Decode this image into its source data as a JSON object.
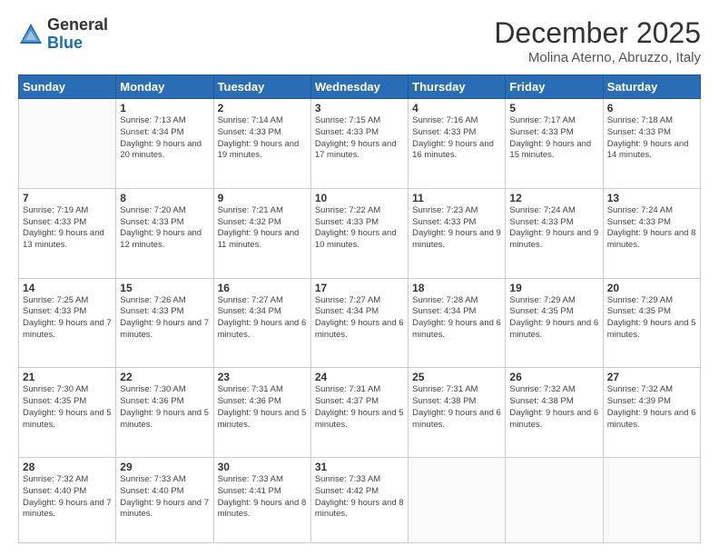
{
  "logo": {
    "general": "General",
    "blue": "Blue"
  },
  "header": {
    "month": "December 2025",
    "location": "Molina Aterno, Abruzzo, Italy"
  },
  "weekdays": [
    "Sunday",
    "Monday",
    "Tuesday",
    "Wednesday",
    "Thursday",
    "Friday",
    "Saturday"
  ],
  "weeks": [
    [
      {
        "day": null
      },
      {
        "day": "1",
        "sunrise": "7:13 AM",
        "sunset": "4:34 PM",
        "daylight": "9 hours and 20 minutes."
      },
      {
        "day": "2",
        "sunrise": "7:14 AM",
        "sunset": "4:33 PM",
        "daylight": "9 hours and 19 minutes."
      },
      {
        "day": "3",
        "sunrise": "7:15 AM",
        "sunset": "4:33 PM",
        "daylight": "9 hours and 17 minutes."
      },
      {
        "day": "4",
        "sunrise": "7:16 AM",
        "sunset": "4:33 PM",
        "daylight": "9 hours and 16 minutes."
      },
      {
        "day": "5",
        "sunrise": "7:17 AM",
        "sunset": "4:33 PM",
        "daylight": "9 hours and 15 minutes."
      },
      {
        "day": "6",
        "sunrise": "7:18 AM",
        "sunset": "4:33 PM",
        "daylight": "9 hours and 14 minutes."
      }
    ],
    [
      {
        "day": "7",
        "sunrise": "7:19 AM",
        "sunset": "4:33 PM",
        "daylight": "9 hours and 13 minutes."
      },
      {
        "day": "8",
        "sunrise": "7:20 AM",
        "sunset": "4:33 PM",
        "daylight": "9 hours and 12 minutes."
      },
      {
        "day": "9",
        "sunrise": "7:21 AM",
        "sunset": "4:32 PM",
        "daylight": "9 hours and 11 minutes."
      },
      {
        "day": "10",
        "sunrise": "7:22 AM",
        "sunset": "4:33 PM",
        "daylight": "9 hours and 10 minutes."
      },
      {
        "day": "11",
        "sunrise": "7:23 AM",
        "sunset": "4:33 PM",
        "daylight": "9 hours and 9 minutes."
      },
      {
        "day": "12",
        "sunrise": "7:24 AM",
        "sunset": "4:33 PM",
        "daylight": "9 hours and 9 minutes."
      },
      {
        "day": "13",
        "sunrise": "7:24 AM",
        "sunset": "4:33 PM",
        "daylight": "9 hours and 8 minutes."
      }
    ],
    [
      {
        "day": "14",
        "sunrise": "7:25 AM",
        "sunset": "4:33 PM",
        "daylight": "9 hours and 7 minutes."
      },
      {
        "day": "15",
        "sunrise": "7:26 AM",
        "sunset": "4:33 PM",
        "daylight": "9 hours and 7 minutes."
      },
      {
        "day": "16",
        "sunrise": "7:27 AM",
        "sunset": "4:34 PM",
        "daylight": "9 hours and 6 minutes."
      },
      {
        "day": "17",
        "sunrise": "7:27 AM",
        "sunset": "4:34 PM",
        "daylight": "9 hours and 6 minutes."
      },
      {
        "day": "18",
        "sunrise": "7:28 AM",
        "sunset": "4:34 PM",
        "daylight": "9 hours and 6 minutes."
      },
      {
        "day": "19",
        "sunrise": "7:29 AM",
        "sunset": "4:35 PM",
        "daylight": "9 hours and 6 minutes."
      },
      {
        "day": "20",
        "sunrise": "7:29 AM",
        "sunset": "4:35 PM",
        "daylight": "9 hours and 5 minutes."
      }
    ],
    [
      {
        "day": "21",
        "sunrise": "7:30 AM",
        "sunset": "4:35 PM",
        "daylight": "9 hours and 5 minutes."
      },
      {
        "day": "22",
        "sunrise": "7:30 AM",
        "sunset": "4:36 PM",
        "daylight": "9 hours and 5 minutes."
      },
      {
        "day": "23",
        "sunrise": "7:31 AM",
        "sunset": "4:36 PM",
        "daylight": "9 hours and 5 minutes."
      },
      {
        "day": "24",
        "sunrise": "7:31 AM",
        "sunset": "4:37 PM",
        "daylight": "9 hours and 5 minutes."
      },
      {
        "day": "25",
        "sunrise": "7:31 AM",
        "sunset": "4:38 PM",
        "daylight": "9 hours and 6 minutes."
      },
      {
        "day": "26",
        "sunrise": "7:32 AM",
        "sunset": "4:38 PM",
        "daylight": "9 hours and 6 minutes."
      },
      {
        "day": "27",
        "sunrise": "7:32 AM",
        "sunset": "4:39 PM",
        "daylight": "9 hours and 6 minutes."
      }
    ],
    [
      {
        "day": "28",
        "sunrise": "7:32 AM",
        "sunset": "4:40 PM",
        "daylight": "9 hours and 7 minutes."
      },
      {
        "day": "29",
        "sunrise": "7:33 AM",
        "sunset": "4:40 PM",
        "daylight": "9 hours and 7 minutes."
      },
      {
        "day": "30",
        "sunrise": "7:33 AM",
        "sunset": "4:41 PM",
        "daylight": "9 hours and 8 minutes."
      },
      {
        "day": "31",
        "sunrise": "7:33 AM",
        "sunset": "4:42 PM",
        "daylight": "9 hours and 8 minutes."
      },
      {
        "day": null
      },
      {
        "day": null
      },
      {
        "day": null
      }
    ]
  ]
}
